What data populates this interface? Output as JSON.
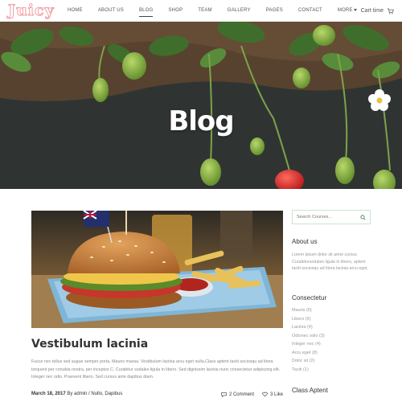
{
  "header": {
    "logo": "Juicy",
    "nav": [
      {
        "label": "HOME"
      },
      {
        "label": "ABOUT US"
      },
      {
        "label": "BLOG",
        "active": true
      },
      {
        "label": "SHOP"
      },
      {
        "label": "TEAM"
      },
      {
        "label": "GALLERY"
      },
      {
        "label": "PAGES"
      },
      {
        "label": "CONTACT"
      },
      {
        "label": "MORE",
        "dropdown": true
      }
    ],
    "cart_label": "Cart time",
    "cart_icon": "cart-icon"
  },
  "hero": {
    "title": "Blog"
  },
  "post": {
    "title": "Vestibulum lacinia",
    "excerpt": "Fusce nec tellus sed augue semper porta. Mauris massa. Vestibulum lacinia arcu eget nulla.Class aptent taciti sociosqu ad litora torquent per conubia nostra, per inceptos C. Curabitur sodales ligula in libero. Sed dignissim lacinia nunc consectetur adipiscing elit. Integer nec odio. Praesent libero. Sed cursus ante dapibus diam.",
    "date": "March 18, 2017",
    "author": "By admin / Nullo, Dapibus",
    "comments": "2 Comment",
    "likes": "3 Like"
  },
  "sidebar": {
    "search_placeholder": "Search Courses...",
    "about": {
      "heading": "About us",
      "text": "Lorem ipsum dolor sit amet cursus Curabitursodales ligula in libero, aptent taciti sociosqu ad litora lacinia arcu eget."
    },
    "consectetur": {
      "heading": "Consectetur",
      "items": [
        "Mauris (6)",
        "Libero (5)",
        "Lacinia (4)",
        "Odionec odio (3)",
        "Integer nec (4)",
        "Arcu eget (8)",
        "Dolor sit (2)",
        "Taciti (1)"
      ]
    },
    "class_aptent": {
      "heading": "Class Aptent"
    }
  },
  "colors": {
    "logo": "#f0a3a7",
    "accent_border": "#cfe3d2"
  }
}
